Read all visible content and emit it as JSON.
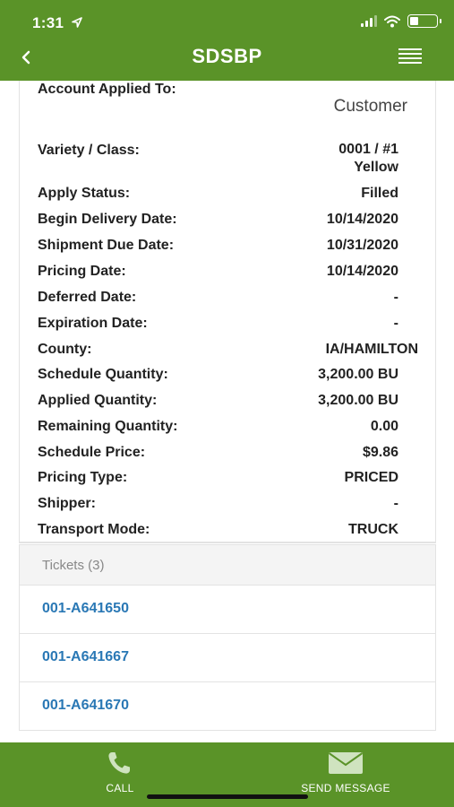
{
  "status_bar": {
    "time": "1:31"
  },
  "header": {
    "title": "SDSBP"
  },
  "details": {
    "account_applied_to": {
      "label": "Account Applied To:",
      "value": "Customer"
    },
    "variety_class": {
      "label": "Variety / Class:",
      "value_line1": "0001 / #1",
      "value_line2": "Yellow"
    },
    "apply_status": {
      "label": "Apply Status:",
      "value": "Filled"
    },
    "begin_delivery_date": {
      "label": "Begin Delivery Date:",
      "value": "10/14/2020"
    },
    "shipment_due_date": {
      "label": "Shipment Due Date:",
      "value": "10/31/2020"
    },
    "pricing_date": {
      "label": "Pricing Date:",
      "value": "10/14/2020"
    },
    "deferred_date": {
      "label": "Deferred Date:",
      "value": "-"
    },
    "expiration_date": {
      "label": "Expiration Date:",
      "value": "-"
    },
    "county": {
      "label": "County:",
      "value": "IA/HAMILTON"
    },
    "schedule_quantity": {
      "label": "Schedule Quantity:",
      "value": "3,200.00 BU"
    },
    "applied_quantity": {
      "label": "Applied Quantity:",
      "value": "3,200.00 BU"
    },
    "remaining_quantity": {
      "label": "Remaining Quantity:",
      "value": "0.00"
    },
    "schedule_price": {
      "label": "Schedule Price:",
      "value": "$9.86"
    },
    "pricing_type": {
      "label": "Pricing Type:",
      "value": "PRICED"
    },
    "shipper": {
      "label": "Shipper:",
      "value": "-"
    },
    "transport_mode": {
      "label": "Transport Mode:",
      "value": "TRUCK"
    }
  },
  "tickets": {
    "header": "Tickets (3)",
    "items": [
      "001-A641650",
      "001-A641667",
      "001-A641670"
    ]
  },
  "footer": {
    "call_label": "CALL",
    "send_message_label": "SEND MESSAGE"
  },
  "colors": {
    "brand_green": "#5a9328",
    "link_blue": "#2a78b5"
  }
}
